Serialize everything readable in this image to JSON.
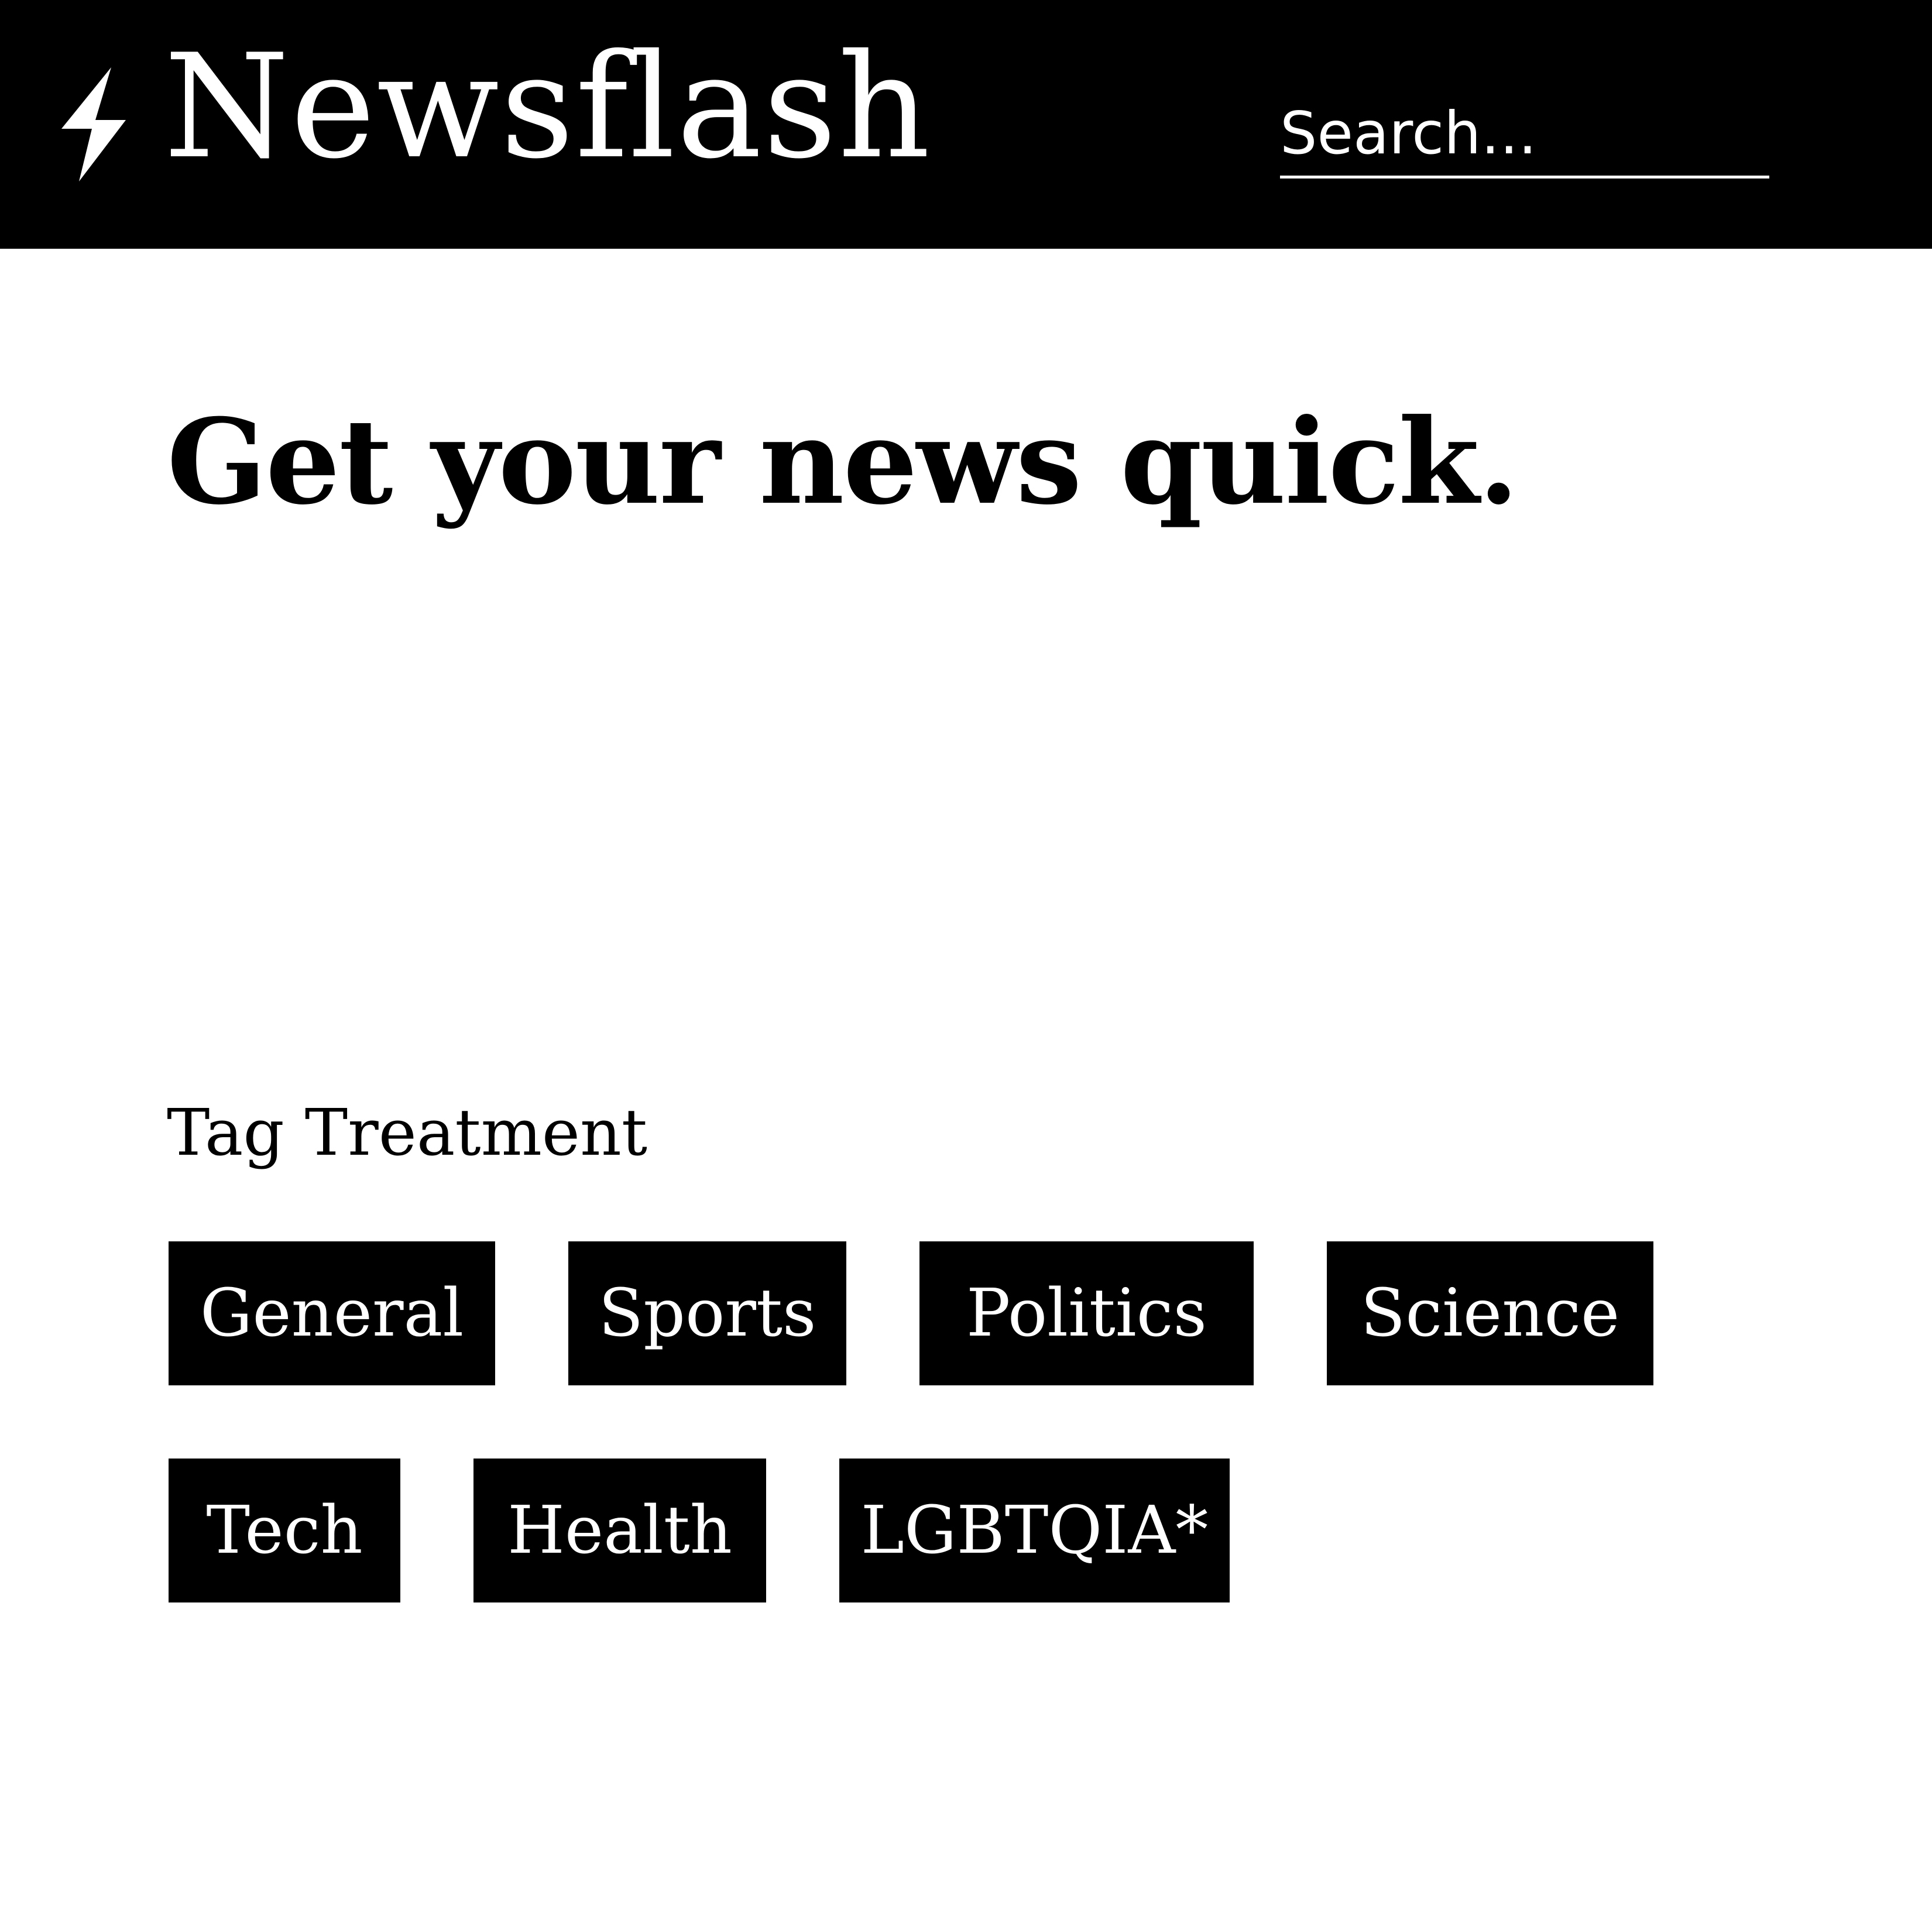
{
  "header": {
    "brand": "Newsflash",
    "logo_icon": "lightning-bolt-icon",
    "search_placeholder": "Search..."
  },
  "main": {
    "headline": "Get your news quick.",
    "section_label": "Tag Treatment",
    "tags": [
      "General",
      "Sports",
      "Politics",
      "Science",
      "Tech",
      "Health",
      "LGBTQIA*"
    ]
  },
  "colors": {
    "header_bg": "#000000",
    "header_text": "#ffffff",
    "tag_bg": "#000000",
    "tag_text": "#ffffff",
    "page_bg": "#ffffff",
    "body_text": "#000000"
  }
}
